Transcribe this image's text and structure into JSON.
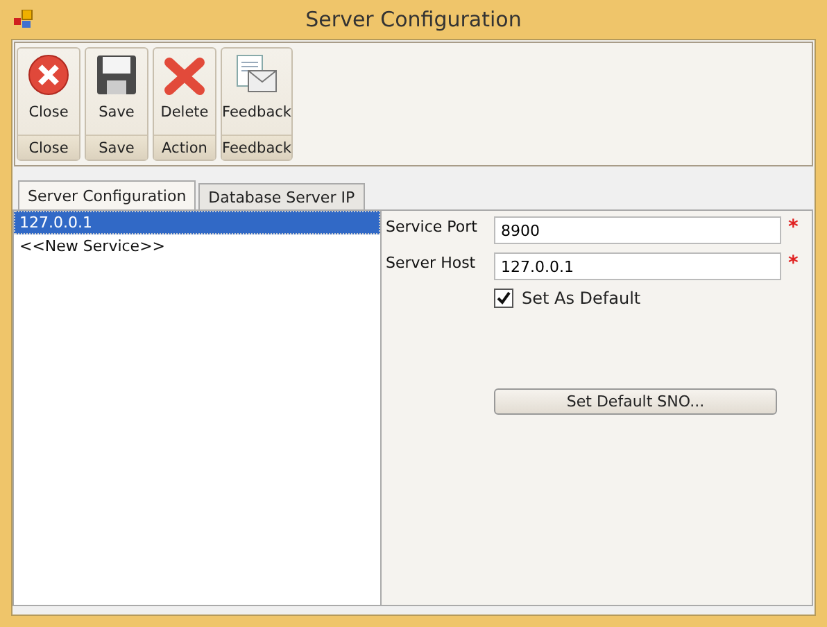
{
  "window": {
    "title": "Server Configuration"
  },
  "toolbar": [
    {
      "label": "Close",
      "group": "Close",
      "kind": "close"
    },
    {
      "label": "Save",
      "group": "Save",
      "kind": "save"
    },
    {
      "label": "Delete",
      "group": "Action",
      "kind": "delete"
    },
    {
      "label": "Feedback",
      "group": "Feedback",
      "kind": "feedback"
    }
  ],
  "tabs": [
    {
      "label": "Server Configuration",
      "selected": true
    },
    {
      "label": "Database Server IP",
      "selected": false
    }
  ],
  "services": [
    {
      "label": "127.0.0.1",
      "selected": true
    },
    {
      "label": "<<New Service>>",
      "selected": false
    }
  ],
  "fields": [
    {
      "label": "Service Port",
      "value": "8900",
      "required": true
    },
    {
      "label": "Server Host",
      "value": "127.0.0.1",
      "required": true
    }
  ],
  "set_as_default": {
    "label": "Set As Default",
    "checked": true
  },
  "set_default_button": "Set Default SNO...",
  "required_mark": "*"
}
